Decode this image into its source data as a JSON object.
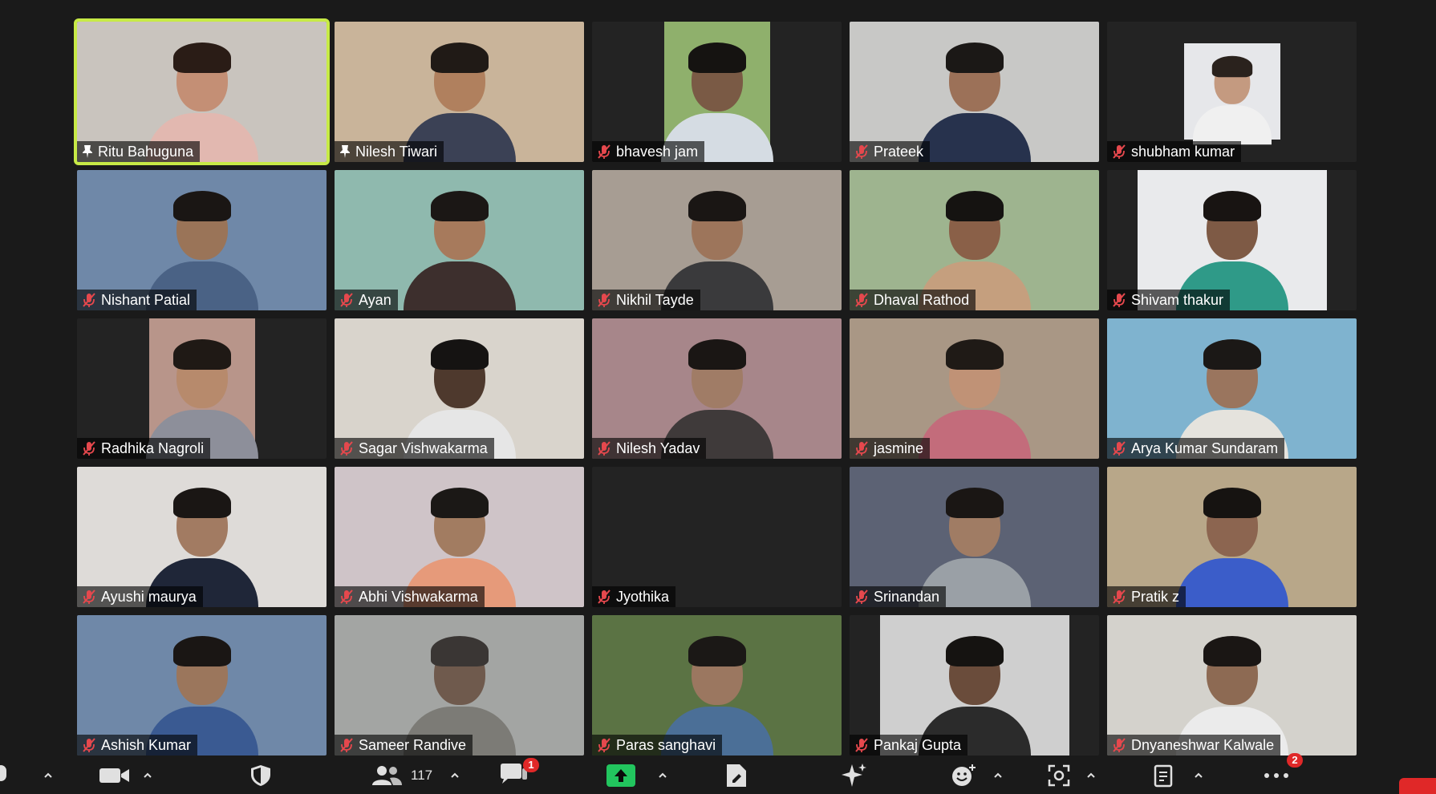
{
  "participants": [
    {
      "name": "Ritu Bahuguna",
      "status": "pinned",
      "active": true,
      "bg": "#c9c4be",
      "skin": "#c48f75",
      "hair": "#2a1c16",
      "shirt": "#e2b8b0",
      "frame": "full"
    },
    {
      "name": "Nilesh Tiwari",
      "status": "pinned",
      "active": false,
      "bg": "#c9b49a",
      "skin": "#b0805e",
      "hair": "#201a16",
      "shirt": "#3b4155",
      "frame": "full"
    },
    {
      "name": "bhavesh jam",
      "status": "muted",
      "active": false,
      "bg": "#8fb06c",
      "skin": "#7a5a45",
      "hair": "#151311",
      "shirt": "#d5dce3",
      "frame": "narrow"
    },
    {
      "name": "Prateek",
      "status": "muted",
      "active": false,
      "bg": "#c8c8c6",
      "skin": "#9c7158",
      "hair": "#1b1816",
      "shirt": "#27324d",
      "frame": "full"
    },
    {
      "name": "shubham kumar",
      "status": "muted",
      "active": false,
      "bg": "#e6e7ea",
      "skin": "#c49a80",
      "hair": "#2a221d",
      "shirt": "#f0f0f0",
      "frame": "narrow3"
    },
    {
      "name": "Nishant Patial",
      "status": "muted",
      "active": false,
      "bg": "#6f88a8",
      "skin": "#9a7458",
      "hair": "#1a1614",
      "shirt": "#4a6285",
      "frame": "full"
    },
    {
      "name": "Ayan",
      "status": "muted",
      "active": false,
      "bg": "#8fb9ae",
      "skin": "#a77a5c",
      "hair": "#1b1715",
      "shirt": "#3d2f2d",
      "frame": "full"
    },
    {
      "name": "Nikhil Tayde",
      "status": "muted",
      "active": false,
      "bg": "#a79d93",
      "skin": "#9d755b",
      "hair": "#1a1614",
      "shirt": "#3a3a3c",
      "frame": "full"
    },
    {
      "name": "Dhaval Rathod",
      "status": "muted",
      "active": false,
      "bg": "#9eb48f",
      "skin": "#8a6048",
      "hair": "#151311",
      "shirt": "#c59f7e",
      "frame": "full"
    },
    {
      "name": "Shivam thakur",
      "status": "muted",
      "active": false,
      "bg": "#e9eaec",
      "skin": "#7e5a45",
      "hair": "#181412",
      "shirt": "#2f9a88",
      "frame": "narrow2"
    },
    {
      "name": "Radhika Nagroli",
      "status": "muted",
      "active": false,
      "bg": "#b8958a",
      "skin": "#b78a6c",
      "hair": "#1f1915",
      "shirt": "#8d8f9a",
      "frame": "narrow"
    },
    {
      "name": "Sagar Vishwakarma",
      "status": "muted",
      "active": false,
      "bg": "#d9d4cc",
      "skin": "#4e392d",
      "hair": "#151312",
      "shirt": "#e6e6e6",
      "frame": "full"
    },
    {
      "name": "Nilesh Yadav",
      "status": "muted",
      "active": false,
      "bg": "#a7868a",
      "skin": "#a07c66",
      "hair": "#1a1614",
      "shirt": "#3f3a3a",
      "frame": "full"
    },
    {
      "name": "jasmine",
      "status": "muted",
      "active": false,
      "bg": "#a99785",
      "skin": "#c09276",
      "hair": "#1f1a16",
      "shirt": "#c36c7b",
      "frame": "full"
    },
    {
      "name": "Arya Kumar Sundaram",
      "status": "muted",
      "active": false,
      "bg": "#7fb3cf",
      "skin": "#9a755e",
      "hair": "#1b1816",
      "shirt": "#e5e3dd",
      "frame": "full"
    },
    {
      "name": "Ayushi maurya",
      "status": "muted",
      "active": false,
      "bg": "#dedbd8",
      "skin": "#a27b62",
      "hair": "#1a1614",
      "shirt": "#1f2638",
      "frame": "full"
    },
    {
      "name": "Abhi Vishwakarma",
      "status": "muted",
      "active": false,
      "bg": "#cfc4c8",
      "skin": "#a27c61",
      "hair": "#1b1816",
      "shirt": "#e69a7a",
      "frame": "full"
    },
    {
      "name": "Jyothika",
      "status": "muted",
      "active": false,
      "bg": "",
      "skin": "",
      "hair": "",
      "shirt": "",
      "frame": "none"
    },
    {
      "name": "Srinandan",
      "status": "muted",
      "active": false,
      "bg": "#5c6274",
      "skin": "#a07c64",
      "hair": "#1a1614",
      "shirt": "#9aa0a6",
      "frame": "full"
    },
    {
      "name": "Pratik z",
      "status": "muted",
      "active": false,
      "bg": "#b8a789",
      "skin": "#8c6550",
      "hair": "#161311",
      "shirt": "#3b5dc9",
      "frame": "full"
    },
    {
      "name": "Ashish Kumar",
      "status": "muted",
      "active": false,
      "bg": "#6f88a8",
      "skin": "#9b765c",
      "hair": "#1a1614",
      "shirt": "#3a5a92",
      "frame": "full"
    },
    {
      "name": "Sameer Randive",
      "status": "muted",
      "active": false,
      "bg": "#a3a5a3",
      "skin": "#6f5a4d",
      "hair": "#3a3634",
      "shirt": "#7c7b76",
      "frame": "full"
    },
    {
      "name": "Paras sanghavi",
      "status": "muted",
      "active": false,
      "bg": "#5b7344",
      "skin": "#9b7760",
      "hair": "#1b1816",
      "shirt": "#4b6f97",
      "frame": "full"
    },
    {
      "name": "Pankaj Gupta",
      "status": "muted",
      "active": false,
      "bg": "#cfcfcf",
      "skin": "#6a4c3b",
      "hair": "#151311",
      "shirt": "#2b2b2b",
      "frame": "narrow2"
    },
    {
      "name": "Dnyaneshwar Kalwale",
      "status": "muted",
      "active": false,
      "bg": "#d4d2cc",
      "skin": "#8d6a53",
      "hair": "#1a1614",
      "shirt": "#ebebeb",
      "frame": "full"
    }
  ],
  "toolbar": {
    "participants_count": "117",
    "chat_badge": "1",
    "more_badge": "2",
    "share_color": "#22c55e",
    "accent_active_border": "#c7ea46",
    "end_color": "#e02828"
  }
}
